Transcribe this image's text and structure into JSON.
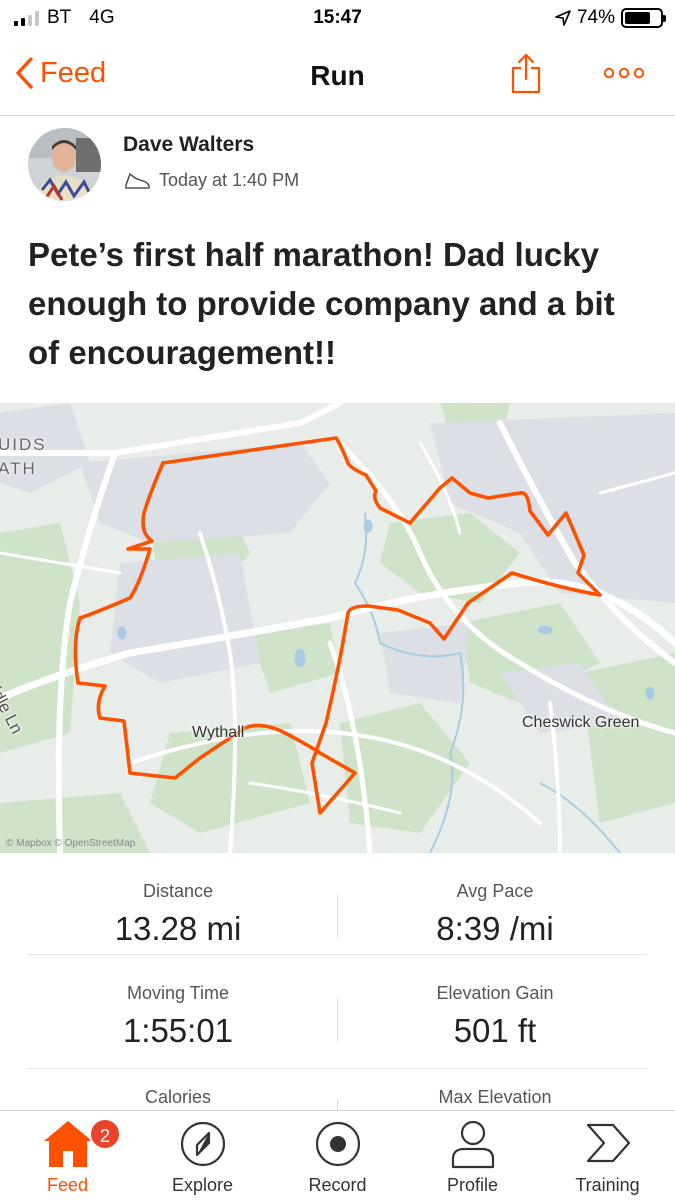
{
  "status_bar": {
    "carrier": "BT",
    "network": "4G",
    "time": "15:47",
    "battery": "74%",
    "battery_level": 0.74,
    "signal_bars": 2
  },
  "nav": {
    "back_label": "Feed",
    "title": "Run",
    "share_icon": "share-icon",
    "more_icon": "more-icon"
  },
  "activity": {
    "author": "Dave Walters",
    "timestamp": "Today at 1:40 PM",
    "sport_icon": "shoe-icon",
    "title": "Pete’s first half marathon!  Dad lucky enough to provide company and a bit of encouragement!!"
  },
  "map": {
    "labels": {
      "druids_heath": "UIDS\nATH",
      "middle_ln": "Middle Ln",
      "wythall": "Wythall",
      "cheswick_green": "Cheswick Green"
    },
    "attribution": "© Mapbox © OpenStreetMap",
    "route_color": "#fc5200"
  },
  "stats": [
    {
      "left": {
        "label": "Distance",
        "value": "13.28 mi"
      },
      "right": {
        "label": "Avg Pace",
        "value": "8:39 /mi"
      }
    },
    {
      "left": {
        "label": "Moving Time",
        "value": "1:55:01"
      },
      "right": {
        "label": "Elevation Gain",
        "value": "501 ft"
      }
    },
    {
      "left": {
        "label": "Calories",
        "value": ""
      },
      "right": {
        "label": "Max Elevation",
        "value": ""
      }
    }
  ],
  "tabs": [
    {
      "label": "Feed",
      "icon": "home-icon",
      "active": true,
      "badge": "2"
    },
    {
      "label": "Explore",
      "icon": "compass-icon"
    },
    {
      "label": "Record",
      "icon": "record-icon"
    },
    {
      "label": "Profile",
      "icon": "person-icon"
    },
    {
      "label": "Training",
      "icon": "training-icon"
    }
  ],
  "colors": {
    "accent": "#fc5200",
    "badge": "#e8442a"
  }
}
